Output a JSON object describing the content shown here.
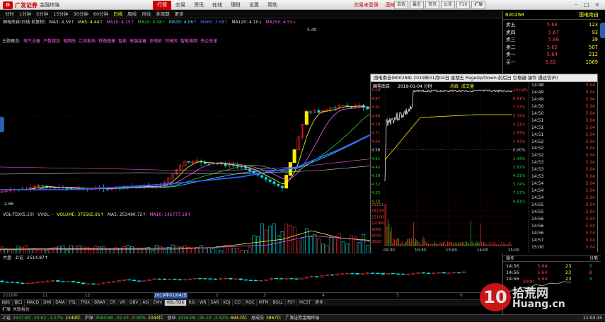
{
  "app": {
    "brand": "广发证券",
    "sub": "金融终端"
  },
  "menu": [
    "行情",
    "交易",
    "资讯",
    "在线",
    "理财",
    "设置",
    "帮助"
  ],
  "title_center": {
    "text1": "交易未登录",
    "text2": "国电南自"
  },
  "toolbar": [
    "自选",
    "最近",
    "资讯",
    "公告",
    "F10",
    "扩展"
  ],
  "periods": [
    "分时",
    "1分钟",
    "5分钟",
    "15分钟",
    "30分钟",
    "60分钟",
    "日线",
    "周线",
    "月线",
    "多周期",
    "更多"
  ],
  "main_indicator": {
    "stock": "国电南自(日线 前复权)",
    "ma3": "MA3: 4.59↑",
    "ma5": "MA5: 4.44↑",
    "ma10": "MA10: 4.15↑",
    "ma20": "MA20: 4.08↑",
    "ma30": "MA30: 4.06↑",
    "ma60": "MA60: 3.68↑",
    "ma120": "MA120: 4.10↓",
    "ma250": "MA250: 4.53↓"
  },
  "concept": [
    "主题概念:",
    "电气设备",
    "户数增加",
    "电网改",
    "江苏板块",
    "铁路基建",
    "智能",
    "高端装备",
    "充电桩",
    "特高压",
    "智能电网",
    "央企改革"
  ],
  "price_marks": {
    "high": "5.40",
    "low": "2.66"
  },
  "vol_indicator": {
    "name": "VOL-TDX(5,10)",
    "vvol": "VVOL: -",
    "volume": "VOLUME: 375565.91↑",
    "ma5": "MA5: 253490.72↑",
    "ma10": "MA10: 142777.19↑"
  },
  "index_indicator": {
    "name": "大盘",
    "label": "上证",
    "value": "2514.87↑"
  },
  "dates": [
    "2018年",
    "11",
    "12",
    "2019年01/04/五",
    "2",
    "3",
    "4",
    "5",
    "6"
  ],
  "ind_tabs": [
    "指标",
    "窗口",
    "MACD",
    "DMI",
    "DMA",
    "FSL",
    "TRIX",
    "BRAR",
    "CR",
    "VR",
    "OBV",
    "ASI",
    "EMV",
    "VOL-TDX",
    "RSI",
    "WR",
    "SAR",
    "KDJ",
    "CCI",
    "ROC",
    "MTM",
    "BOLL",
    "PSY",
    "MCST",
    "更多"
  ],
  "sub_tabs": [
    "扩展",
    "关联报价"
  ],
  "status": [
    {
      "name": "上证",
      "v1": "2637.80",
      "v2": "-33.62",
      "v3": "-1.17%",
      "v4": "1549亿"
    },
    {
      "name": "沪深",
      "v1": "3564.68",
      "v2": "-32.43",
      "v3": "-0.90%",
      "v4": "1044亿"
    },
    {
      "name": "创业",
      "v1": "1416.06",
      "v2": "-35.12",
      "v3": "-2.42%",
      "v4": "694.0亿"
    },
    {
      "name": "总成交",
      "v1": "3867亿",
      "v2": "",
      "v3": "",
      "v4": ""
    }
  ],
  "status_right": {
    "broker": "广发证券金融终端",
    "time": "11:03:15"
  },
  "quote": {
    "code": "600268",
    "name": "国电南自",
    "sell": [
      {
        "label": "卖五",
        "price": "5.68",
        "vol": "123"
      },
      {
        "label": "卖四",
        "price": "5.67",
        "vol": "93"
      },
      {
        "label": "卖三",
        "price": "5.66",
        "vol": "39"
      },
      {
        "label": "卖二",
        "price": "5.65",
        "vol": "507"
      },
      {
        "label": "卖一",
        "price": "5.64",
        "vol": "212"
      },
      {
        "label": "买一",
        "price": "5.62",
        "vol": "1069"
      }
    ],
    "ticks_label": "分笔",
    "ticks": [
      {
        "t": "14:56",
        "p": "5.64",
        "v": "23",
        "d": "S"
      },
      {
        "t": "14:56",
        "p": "5.64",
        "v": "23",
        "d": "B"
      },
      {
        "t": "14:56",
        "p": "5.64",
        "v": "23",
        "d": "S"
      }
    ],
    "ops": "操作"
  },
  "popup": {
    "title": "国电南自(600268)  2019年01月04日 星期五 PageUp/Down:前后日 空格键:操作 通达信(R)",
    "subtitle": "国电南自",
    "datelabel": "2019-01-04 分时",
    "tabs": [
      "均线",
      "成交量"
    ],
    "prices": [
      "5.04",
      "4.97",
      "4.91",
      "4.84",
      "4.78",
      "4.71",
      "4.64",
      "4.58",
      "4.51",
      "4.45",
      "4.38",
      "4.32",
      "4.25",
      "4.19"
    ],
    "pcts": [
      "10.04%",
      "8.61%",
      "7.17%",
      "5.74%",
      "4.31%",
      "2.87%",
      "1.43%",
      "0.00%",
      "1.43%",
      "2.87%",
      "4.31%",
      "5.74%",
      "7.17%",
      "8.61%"
    ],
    "vols": [
      "21151",
      "18129",
      "15108",
      "12086",
      "9065",
      "6043",
      "3022"
    ],
    "times": [
      "09:30",
      "10:30",
      "13:00",
      "14:00",
      "15:00"
    ],
    "ticks": [
      {
        "t": "14:48",
        "p": "5.04"
      },
      {
        "t": "14:49",
        "p": "5.04"
      },
      {
        "t": "14:49",
        "p": "5.04"
      },
      {
        "t": "14:50",
        "p": "5.04"
      },
      {
        "t": "14:50",
        "p": "5.04"
      },
      {
        "t": "14:51",
        "p": "5.04"
      },
      {
        "t": "14:51",
        "p": "5.04"
      },
      {
        "t": "14:51",
        "p": "5.04"
      },
      {
        "t": "14:52",
        "p": "5.04"
      },
      {
        "t": "14:52",
        "p": "5.04"
      },
      {
        "t": "14:52",
        "p": "5.04"
      },
      {
        "t": "14:53",
        "p": "5.04"
      },
      {
        "t": "14:53",
        "p": "5.04"
      },
      {
        "t": "14:53",
        "p": "5.04"
      },
      {
        "t": "14:54",
        "p": "5.04"
      },
      {
        "t": "14:54",
        "p": "5.04"
      },
      {
        "t": "14:54",
        "p": "5.04"
      },
      {
        "t": "14:55",
        "p": "5.04"
      },
      {
        "t": "14:55",
        "p": "5.04"
      },
      {
        "t": "14:56",
        "p": "5.04"
      },
      {
        "t": "14:56",
        "p": "5.04"
      },
      {
        "t": "14:56",
        "p": "5.04"
      },
      {
        "t": "14:57",
        "p": "5.04"
      },
      {
        "t": "15:00",
        "p": "5.04"
      }
    ]
  },
  "watermark": {
    "big": "10",
    "text": "拾荒网",
    "url": "Huang.cn"
  }
}
